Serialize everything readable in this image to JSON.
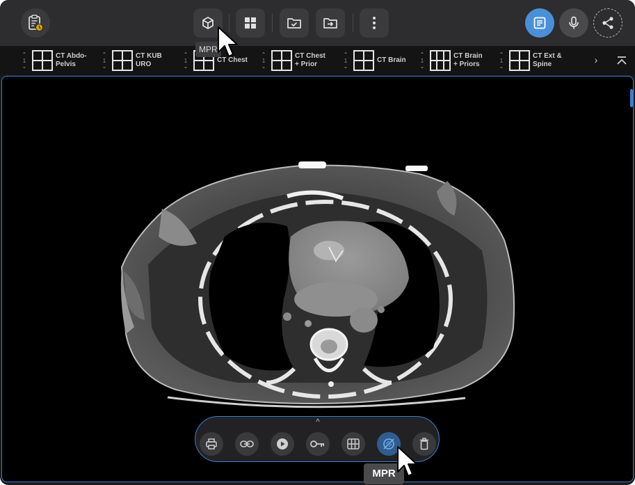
{
  "toolbar": {
    "buttons": [
      {
        "name": "clipboard-icon"
      },
      {
        "name": "cube-3d-icon",
        "tooltip": "MPR"
      },
      {
        "name": "grid-layout-icon"
      },
      {
        "name": "folder-check-icon"
      },
      {
        "name": "folder-export-icon"
      },
      {
        "name": "more-vertical-icon"
      },
      {
        "name": "report-icon"
      },
      {
        "name": "microphone-icon"
      },
      {
        "name": "share-icon"
      }
    ],
    "accent": "#4a90d9"
  },
  "protocols": [
    {
      "line1": "CT Abdo-",
      "line2": "Pelvis",
      "count": "1",
      "layout": "2x2"
    },
    {
      "line1": "CT KUB",
      "line2": "URO",
      "count": "1",
      "layout": "2x2"
    },
    {
      "line1": "CT Chest",
      "line2": "",
      "count": "1",
      "layout": "2x2"
    },
    {
      "line1": "CT Chest",
      "line2": "+ Prior",
      "count": "1",
      "layout": "2x2"
    },
    {
      "line1": "CT Brain",
      "line2": "",
      "count": "1",
      "layout": "2x2"
    },
    {
      "line1": "CT Brain",
      "line2": "+ Priors",
      "count": "1",
      "layout": "3x2"
    },
    {
      "line1": "CT Ext &",
      "line2": "Spine",
      "count": "1",
      "layout": "2x2"
    }
  ],
  "viewer_tools": {
    "buttons": [
      {
        "name": "print-icon"
      },
      {
        "name": "link-icon"
      },
      {
        "name": "play-icon"
      },
      {
        "name": "key-image-icon"
      },
      {
        "name": "table-grid-icon"
      },
      {
        "name": "mpr-disabled-icon",
        "tooltip": "MPR"
      },
      {
        "name": "trash-icon"
      }
    ]
  },
  "tooltips": {
    "top": "MPR",
    "bottom": "MPR"
  }
}
